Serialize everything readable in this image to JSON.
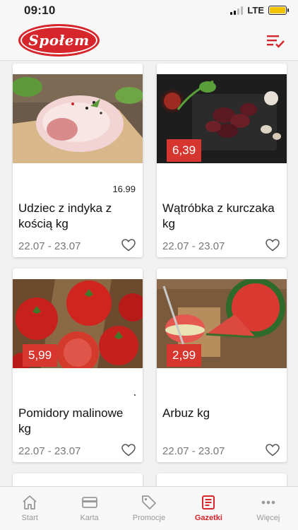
{
  "status_bar": {
    "time": "09:10",
    "network": "LTE"
  },
  "header": {
    "logo_text": "Społem"
  },
  "products": [
    {
      "name": "Udziec z indyka z kością kg",
      "price": "16.99",
      "price_style": "plain",
      "dates": "22.07 - 23.07",
      "image": "turkey-leg"
    },
    {
      "name": "Wątróbka z kurczaka kg",
      "price": "6,39",
      "price_style": "badge",
      "dates": "22.07 - 23.07",
      "image": "chicken-liver"
    },
    {
      "name": "Pomidory malinowe kg",
      "price": "5,99",
      "price_style": "badge",
      "dates": "22.07 - 23.07",
      "image": "tomatoes"
    },
    {
      "name": "Arbuz kg",
      "price": "2,99",
      "price_style": "badge",
      "dates": "22.07 - 23.07",
      "image": "watermelon"
    }
  ],
  "tabs": [
    {
      "label": "Start",
      "icon": "home-icon"
    },
    {
      "label": "Karta",
      "icon": "card-icon"
    },
    {
      "label": "Promocje",
      "icon": "tag-icon"
    },
    {
      "label": "Gazetki",
      "icon": "newspaper-icon",
      "active": true
    },
    {
      "label": "Więcej",
      "icon": "more-icon"
    }
  ],
  "colors": {
    "accent": "#d6262c",
    "badge": "#d6362e",
    "inactive": "#999999"
  }
}
